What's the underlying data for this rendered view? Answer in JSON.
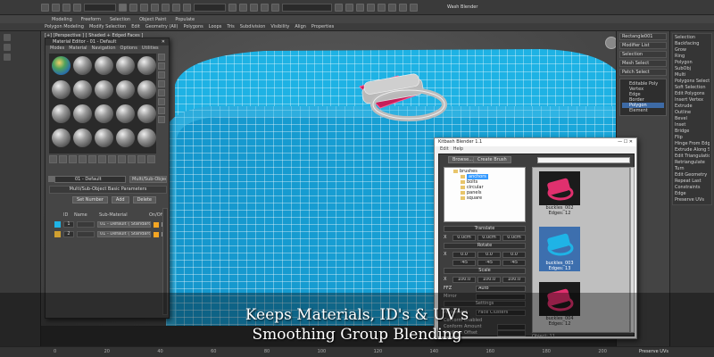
{
  "app": {
    "user_label": "Wash Blender",
    "ribbon_tabs": [
      "Modeling",
      "Freeform",
      "Selection",
      "Object Paint",
      "Populate"
    ],
    "ribbon_items": [
      "Polygon Modeling",
      "Modify Selection",
      "Edit",
      "Geometry (All)",
      "Polygons",
      "Loops",
      "Tris",
      "Subdivision",
      "Visibility",
      "Align",
      "Properties"
    ]
  },
  "viewport": {
    "label": "[+] [Perspective ] [ Shaded + Edged Faces ]"
  },
  "command_panel": {
    "object_name": "Rectangle001",
    "modifier_list": "Modifier List",
    "tabs": [
      "Selection",
      "Mesh Select",
      "Patch Select",
      "Unwrap UVW"
    ],
    "stack": [
      "Editable Poly",
      "Vertex",
      "Edge",
      "Border",
      "Polygon",
      "Element"
    ],
    "active_stack_item": "Polygon"
  },
  "right_panel": {
    "items": [
      "Selection",
      "Backfacing",
      "Grow",
      "Ring",
      "Polygon",
      "SubObj",
      "Multi",
      "Polygons Selected",
      "Soft Selection",
      "Edit Polygons",
      "Insert Vertex",
      "Extrude",
      "Outline",
      "Bevel",
      "Inset",
      "Bridge",
      "Flip",
      "Hinge From Edge",
      "Extrude Along Spline",
      "Edit Triangulation",
      "Retriangulate",
      "Turn",
      "Edit Geometry",
      "Repeat Last",
      "Constraints",
      "Edge",
      "Preserve UVs"
    ]
  },
  "material_editor": {
    "title": "Material Editor - 01 - Default",
    "menu": [
      "Modes",
      "Material",
      "Navigation",
      "Options",
      "Utilities"
    ],
    "material_name": "01 - Default",
    "material_type": "Multi/Sub-Object",
    "rollout_title": "Multi/Sub-Object Basic Parameters",
    "set_number_label": "Set Number",
    "add_label": "Add",
    "delete_label": "Delete",
    "columns": [
      "ID",
      "Name",
      "Sub-Material",
      "On/Off"
    ],
    "rows": [
      {
        "id": "1",
        "name": "",
        "sub_material": "01 - Default ( Standard )",
        "color": "#f5a623"
      },
      {
        "id": "2",
        "name": "",
        "sub_material": "01 - Default ( Standard )",
        "color": "#f5a623"
      }
    ]
  },
  "kitbash": {
    "title": "Kitbash Blender 1.1",
    "menu": [
      "Edit",
      "Help"
    ],
    "browse_label": "Browse...",
    "create_brush_label": "Create Brush",
    "tree": [
      {
        "label": "brushes",
        "level": 1
      },
      {
        "label": "anchors",
        "level": 2,
        "selected": true
      },
      {
        "label": "bolts",
        "level": 2
      },
      {
        "label": "circular",
        "level": 2
      },
      {
        "label": "panels",
        "level": 2
      },
      {
        "label": "square",
        "level": 2
      }
    ],
    "translate_label": "Translate",
    "rotate_label": "Rotate",
    "scale_label": "Scale",
    "translate_values": [
      "0.0cm",
      "0.0cm",
      "0.0cm"
    ],
    "rotate_values": [
      "0.0",
      "0.0",
      "0.0"
    ],
    "rotate_values2": [
      "-45",
      "-45",
      "-45"
    ],
    "scale_values": [
      "100.0",
      "100.0",
      "100.0"
    ],
    "fit_label": "FFZ",
    "fit_value": "Auto",
    "mirror_label": "Mirror",
    "settings_label": "Settings",
    "placement_label": "Placement",
    "placement_value": "Face Clusters",
    "conform_enabled_label": "Conform Enabled",
    "conform_amount_label": "Conform Amount",
    "conform_offset_label": "Conform Offset",
    "thumbnails": [
      {
        "name": "buckles_002",
        "edges": "Edges: 12",
        "color": "#e0306e",
        "selected": false
      },
      {
        "name": "buckles_003",
        "edges": "Edges: 13",
        "color": "#1fb3e6",
        "selected": true
      },
      {
        "name": "buckles_004",
        "edges": "Edges: 12",
        "color": "#e0306e",
        "selected": false
      }
    ],
    "status": "Object: 11"
  },
  "caption": {
    "line1": "Keeps Materials, ID's & UV's",
    "line2": "Smoothing Group Blending"
  },
  "timeline": {
    "ticks": [
      "0",
      "20",
      "40",
      "60",
      "80",
      "100",
      "120",
      "140",
      "160",
      "180",
      "200"
    ],
    "preserve_label": "Preserve UVs"
  },
  "colors": {
    "mesh_blue": "#1fb3e6",
    "wire": "#ffffff",
    "selection_red": "#e0306e",
    "accent_blue": "#3d6aa5"
  }
}
